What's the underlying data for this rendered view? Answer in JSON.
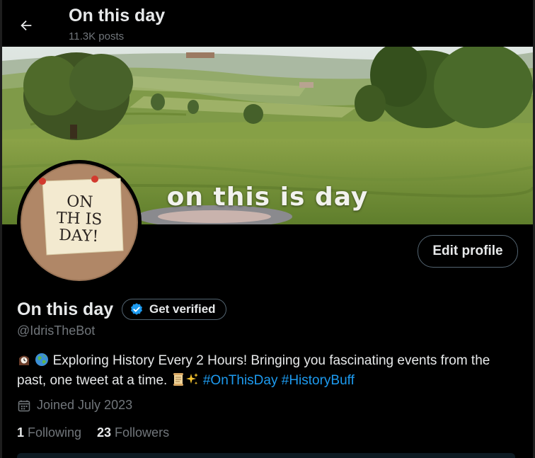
{
  "header": {
    "title": "On this day",
    "posts_count": "11.3K posts"
  },
  "banner": {
    "overlay_text": "on this is day"
  },
  "avatar": {
    "note_text": "ON\nTH IS\nDAY!"
  },
  "actions": {
    "edit_profile_label": "Edit profile"
  },
  "profile": {
    "display_name": "On this day",
    "get_verified_label": "Get verified",
    "handle": "@IdrisTheBot",
    "bio_text": "Exploring History Every 2 Hours! Bringing you fascinating events from the past, one tweet at a time.",
    "bio_hashtags": [
      "#OnThisDay",
      "#HistoryBuff"
    ],
    "joined": "Joined July 2023",
    "following_count": "1",
    "following_label": "Following",
    "followers_count": "23",
    "followers_label": "Followers"
  },
  "icons": {
    "back": "arrow-left-icon",
    "verified": "verified-badge-icon",
    "calendar": "calendar-icon",
    "bio_emojis": [
      "mantel-clock-emoji",
      "globe-emoji",
      "scroll-emoji",
      "sparkles-emoji"
    ]
  },
  "colors": {
    "background": "#000000",
    "text": "#e7e9ea",
    "muted": "#71767b",
    "accent": "#1d9bf0",
    "border": "#536471"
  }
}
